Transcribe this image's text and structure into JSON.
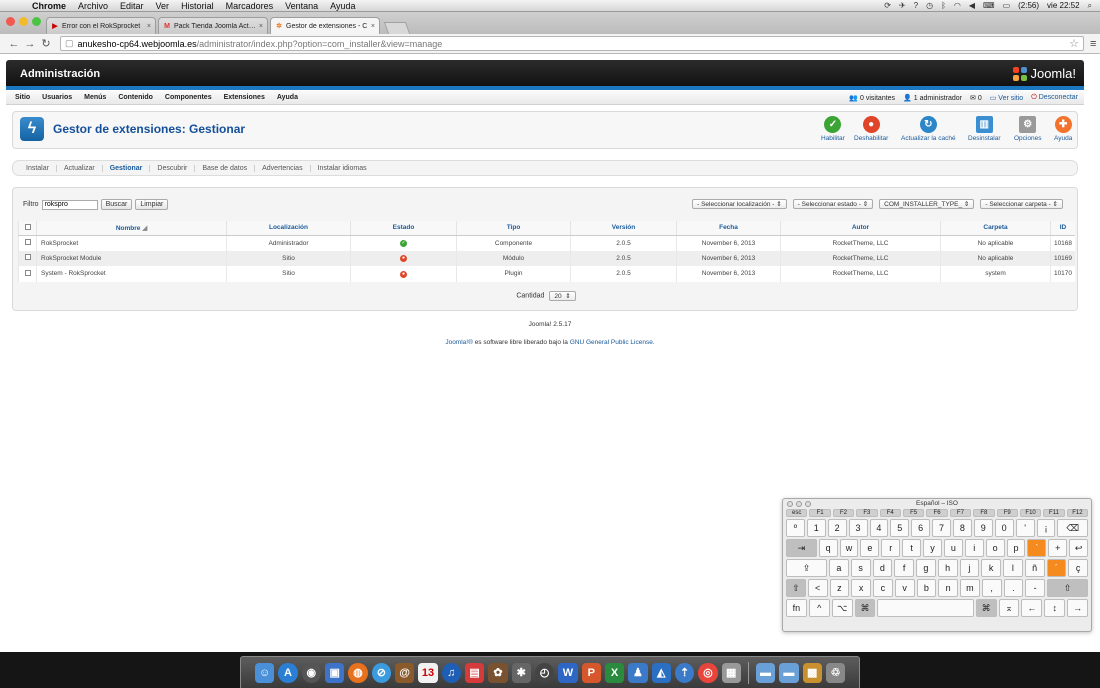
{
  "menubar": {
    "app": "Chrome",
    "items": [
      "Archivo",
      "Editar",
      "Ver",
      "Historial",
      "Marcadores",
      "Ventana",
      "Ayuda"
    ],
    "battery": "(2:56)",
    "clock": "vie 22:52"
  },
  "browser": {
    "tabs": [
      {
        "label": "Error con el RokSprocket",
        "favicon": "youtube-icon",
        "active": false
      },
      {
        "label": "Pack Tienda Joomla Activo",
        "favicon": "gmail-icon",
        "active": false
      },
      {
        "label": "Gestor de extensiones - C",
        "favicon": "joomla-icon",
        "active": true
      }
    ],
    "url_host": "anukesho-cp64.webjoomla.es",
    "url_path": "/administrator/index.php?option=com_installer&view=manage"
  },
  "joomla": {
    "header_title": "Administración",
    "brand": "Joomla!",
    "menu": [
      "Sitio",
      "Usuarios",
      "Menús",
      "Contenido",
      "Componentes",
      "Extensiones",
      "Ayuda"
    ],
    "status": {
      "visitors": "0 visitantes",
      "admins": "1 administrador",
      "messages": "0",
      "view_site": "Ver sitio",
      "logout": "Desconectar"
    },
    "page_title": "Gestor de extensiones: Gestionar",
    "toolbar": [
      "Habilitar",
      "Deshabilitar",
      "Actualizar la caché",
      "Desinstalar",
      "Opciones",
      "Ayuda"
    ],
    "subnav": [
      "Instalar",
      "Actualizar",
      "Gestionar",
      "Descubrir",
      "Base de datos",
      "Advertencias",
      "Instalar idiomas"
    ],
    "subnav_active": "Gestionar",
    "filter_label": "Filtro",
    "filter_value": "rokspro",
    "search_btn": "Buscar",
    "clear_btn": "Limpiar",
    "selects": [
      "- Seleccionar localización -",
      "- Seleccionar estado -",
      "COM_INSTALLER_TYPE_",
      "- Seleccionar carpeta -"
    ],
    "columns": [
      "Nombre",
      "Localización",
      "Estado",
      "Tipo",
      "Versión",
      "Fecha",
      "Autor",
      "Carpeta",
      "ID"
    ],
    "rows": [
      {
        "name": "RokSprocket",
        "location": "Administrador",
        "status": "enabled",
        "type": "Componente",
        "version": "2.0.5",
        "date": "November 6, 2013",
        "author": "RocketTheme, LLC",
        "folder": "No aplicable",
        "id": "10168"
      },
      {
        "name": "RokSprocket Module",
        "location": "Sitio",
        "status": "disabled",
        "type": "Módulo",
        "version": "2.0.5",
        "date": "November 6, 2013",
        "author": "RocketTheme, LLC",
        "folder": "No aplicable",
        "id": "10169"
      },
      {
        "name": "System - RokSprocket",
        "location": "Sitio",
        "status": "disabled",
        "type": "Plugin",
        "version": "2.0.5",
        "date": "November 6, 2013",
        "author": "RocketTheme, LLC",
        "folder": "system",
        "id": "10170"
      }
    ],
    "quantity_label": "Cantidad",
    "quantity_value": "20",
    "footer_version": "Joomla! 2.5.17",
    "footer_link1": "Joomla!®",
    "footer_text": " es software libre liberado bajo la ",
    "footer_link2": "GNU General Public License",
    "footer_end": "."
  },
  "keyboard": {
    "title": "Español – ISO",
    "frow": [
      "esc",
      "F1",
      "F2",
      "F3",
      "F4",
      "F5",
      "F6",
      "F7",
      "F8",
      "F9",
      "F10",
      "F11",
      "F12"
    ],
    "row1": [
      "º",
      "1",
      "2",
      "3",
      "4",
      "5",
      "6",
      "7",
      "8",
      "9",
      "0",
      "'",
      "¡",
      "⌫"
    ],
    "row2": [
      "⇥",
      "q",
      "w",
      "e",
      "r",
      "t",
      "y",
      "u",
      "i",
      "o",
      "p",
      "`",
      "+",
      "↩"
    ],
    "row3": [
      "⇪",
      "a",
      "s",
      "d",
      "f",
      "g",
      "h",
      "j",
      "k",
      "l",
      "ñ",
      "´",
      "ç"
    ],
    "row4": [
      "⇧",
      "<",
      "z",
      "x",
      "c",
      "v",
      "b",
      "n",
      "m",
      ",",
      ".",
      "-",
      "⇧"
    ],
    "row5": [
      "fn",
      "^",
      "⌥",
      "⌘",
      "",
      "⌘",
      "⌅",
      "←",
      "↕",
      "→"
    ]
  },
  "colors": {
    "joomla_blue": "#14509a",
    "link_blue": "#1a5a9a",
    "enabled_green": "#3aa534",
    "disabled_red": "#e0452a",
    "key_orange": "#f58a1f"
  }
}
